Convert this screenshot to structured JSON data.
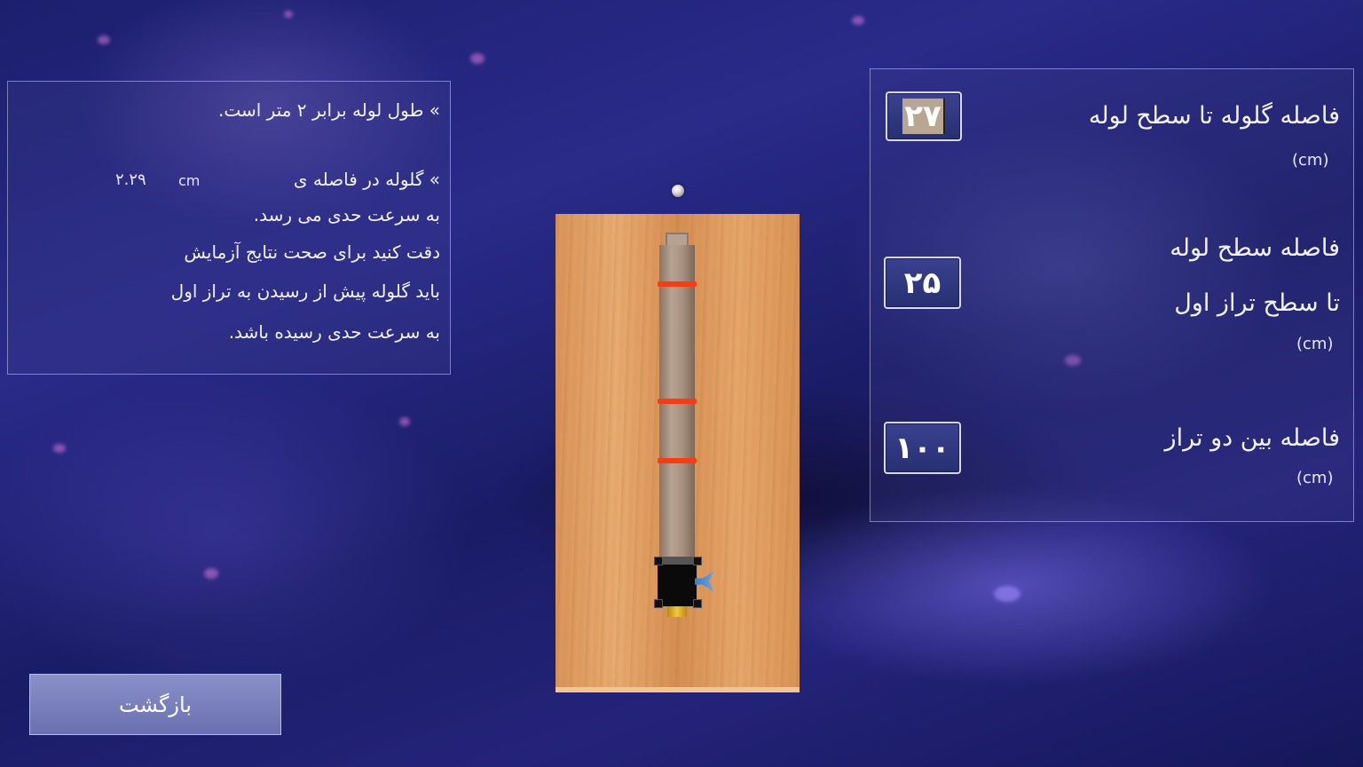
{
  "info": {
    "tube_length_line": "» طول لوله برابر ۲ متر است.",
    "terminal_prefix": "» گلوله در فاصله ی",
    "terminal_unit": "cm",
    "terminal_value": "۲.۲۹",
    "line3": "به سرعت حدی می رسد.",
    "line4": "دقت کنید برای صحت نتایج آزمایش",
    "line5": "باید گلوله پیش از رسیدن به تراز اول",
    "line6": "به سرعت حدی رسیده باشد."
  },
  "settings": {
    "ball_distance": {
      "label": "فاصله گلوله تا سطح لوله",
      "unit": "(cm)",
      "value": "۲۷"
    },
    "surface_distance": {
      "label_line1": "فاصله سطح لوله",
      "label_line2": "تا سطح تراز اول",
      "unit": "(cm)",
      "value": "۲۵"
    },
    "level_distance": {
      "label": "فاصله بین دو تراز",
      "unit": "(cm)",
      "value": "۱۰۰"
    }
  },
  "back_button": {
    "label": "بازگشت"
  },
  "colors": {
    "level_mark": "#ff3a10",
    "valve": "#3b7cc8",
    "outlet": "#f0c840"
  }
}
